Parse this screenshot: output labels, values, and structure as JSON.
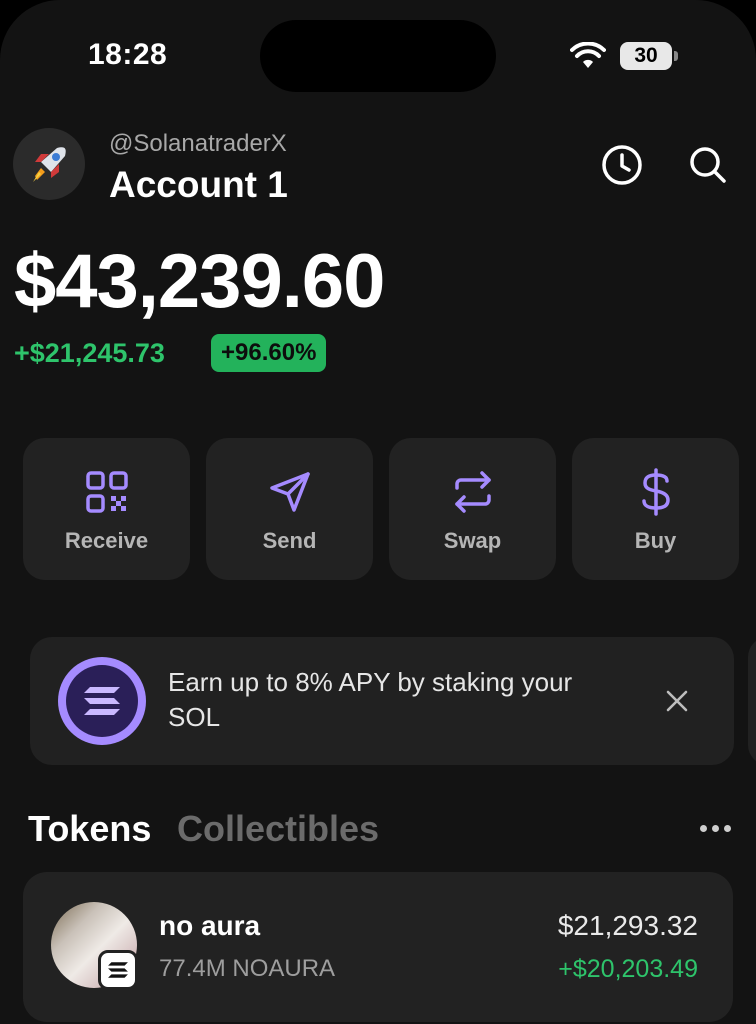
{
  "status_bar": {
    "time": "18:28",
    "battery": "30"
  },
  "header": {
    "avatar_emoji": "🚀",
    "username": "@SolanatraderX",
    "account_name": "Account 1"
  },
  "balance": {
    "total": "$43,239.60",
    "change_amount": "+$21,245.73",
    "change_percent": "+96.60%"
  },
  "actions": [
    {
      "label": "Receive",
      "icon": "qr-code-icon"
    },
    {
      "label": "Send",
      "icon": "send-arrow-icon"
    },
    {
      "label": "Swap",
      "icon": "swap-arrows-icon"
    },
    {
      "label": "Buy",
      "icon": "dollar-icon"
    }
  ],
  "promo": {
    "text": "Earn up to 8% APY by staking your SOL",
    "icon": "solana-logo-icon"
  },
  "tabs": [
    {
      "label": "Tokens",
      "active": true
    },
    {
      "label": "Collectibles",
      "active": false
    }
  ],
  "tokens": [
    {
      "name": "no aura",
      "amount": "77.4M NOAURA",
      "value": "$21,293.32",
      "change": "+$20,203.49"
    }
  ],
  "colors": {
    "accent_purple": "#a58bff",
    "positive_green": "#2ec46b",
    "card_bg": "#222222",
    "background": "#131313"
  }
}
